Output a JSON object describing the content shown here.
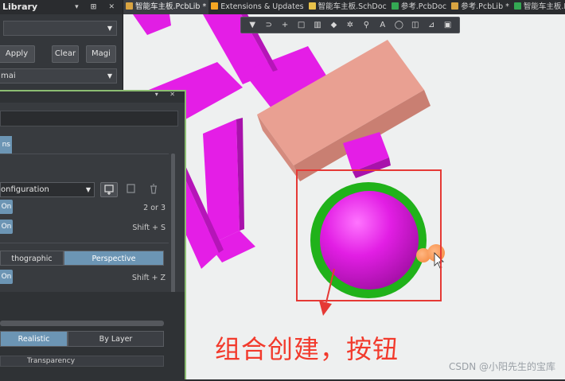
{
  "library_panel": {
    "title": "Library",
    "title_buttons": "▾ ⊞ ✕",
    "filter_dropdown": "",
    "apply_label": "Apply",
    "clear_label": "Clear",
    "magnify_label": "Magi",
    "mask_dropdown": "mai"
  },
  "tabs": [
    {
      "label": "智能车主板.PcbLib *",
      "active": true,
      "icon_color": "#d9a441"
    },
    {
      "label": "Extensions & Updates",
      "active": false,
      "icon_color": "#f5a623"
    },
    {
      "label": "智能车主板.SchDoc",
      "active": false,
      "icon_color": "#e8c14a"
    },
    {
      "label": "参考.PcbDoc",
      "active": false,
      "icon_color": "#34a853"
    },
    {
      "label": "参考.PcbLib *",
      "active": false,
      "icon_color": "#d9a441"
    },
    {
      "label": "智能车主板.PcbDoc",
      "active": false,
      "icon_color": "#34a853"
    }
  ],
  "toolbar_icons": [
    "filter-icon",
    "route-icon",
    "plus-icon",
    "rect-icon",
    "chart-icon",
    "layer-icon",
    "gear-icon",
    "pin-icon",
    "text-icon",
    "circle-icon",
    "select-icon",
    "measure-icon",
    "window-icon"
  ],
  "view_panel": {
    "title_buttons": "▾ ✕",
    "tab_label": "ns",
    "config_dropdown": "onfiguration",
    "on1_label": "On",
    "on1_shortcut": "2 or 3",
    "on2_label": "On",
    "on2_shortcut": "Shift + S",
    "orthographic_label": "thographic",
    "perspective_label": "Perspective",
    "on3_label": "On",
    "on3_shortcut": "Shift + Z",
    "realistic_label": "Realistic",
    "by_layer_label": "By Layer",
    "transparency_label": "Transparency"
  },
  "annotation": {
    "caption": "组合创建，按钮",
    "watermark": "CSDN @小阳先生的宝库"
  },
  "colors": {
    "accent_blue": "#6c95b4",
    "panel_border_green": "#8cbd72",
    "annotation_red": "#e53935",
    "component_magenta": "#e41ee6",
    "component_salmon": "#e9a092",
    "ring_green": "#20b21a"
  }
}
